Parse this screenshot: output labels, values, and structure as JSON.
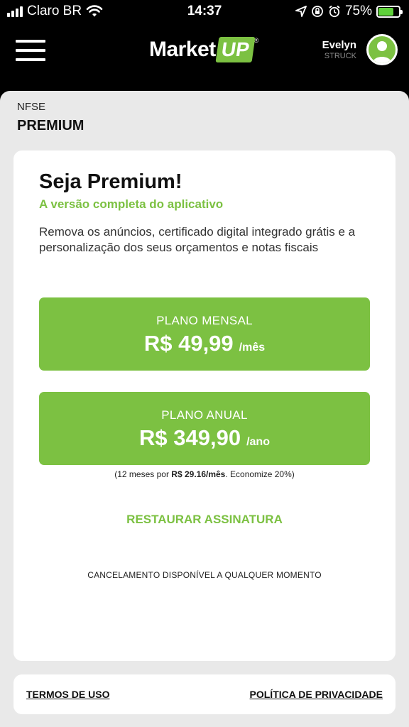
{
  "status_bar": {
    "carrier": "Claro BR",
    "time": "14:37",
    "battery_percent": "75%",
    "battery_level": 0.75,
    "icons": [
      "signal-icon",
      "wifi-icon",
      "location-icon",
      "orientation-lock-icon",
      "alarm-icon",
      "battery-icon"
    ]
  },
  "header": {
    "logo_market": "Market",
    "logo_up": "UP",
    "logo_reg": "®",
    "user_first_name": "Evelyn",
    "user_last_name": "STRUCK",
    "menu_icon": "hamburger-icon",
    "avatar_icon": "user-avatar-icon"
  },
  "page": {
    "breadcrumb": "NFSE",
    "title": "PREMIUM"
  },
  "promo": {
    "headline": "Seja Premium!",
    "tagline": "A versão completa do aplicativo",
    "description": "Remova os anúncios, certificado digital integrado grátis e a personalização dos seus orçamentos e notas fiscais"
  },
  "plans": [
    {
      "label": "PLANO MENSAL",
      "price": "R$ 49,99",
      "period": "/mês"
    },
    {
      "label": "PLANO ANUAL",
      "price": "R$ 349,90",
      "period": "/ano"
    }
  ],
  "annual_note": {
    "prefix": "(12 meses por ",
    "price": "R$ 29.16/mês",
    "suffix": ". Economize 20%)"
  },
  "restore_label": "RESTAURAR ASSINATURA",
  "cancel_note": "CANCELAMENTO DISPONÍVEL A QUALQUER MOMENTO",
  "footer": {
    "terms": "TERMOS DE USO",
    "privacy": "POLÍTICA DE PRIVACIDADE"
  },
  "colors": {
    "accent_green": "#7cc142",
    "header_bg": "#000000",
    "sheet_bg": "#e9e9e9",
    "battery_green": "#5fd13b"
  }
}
